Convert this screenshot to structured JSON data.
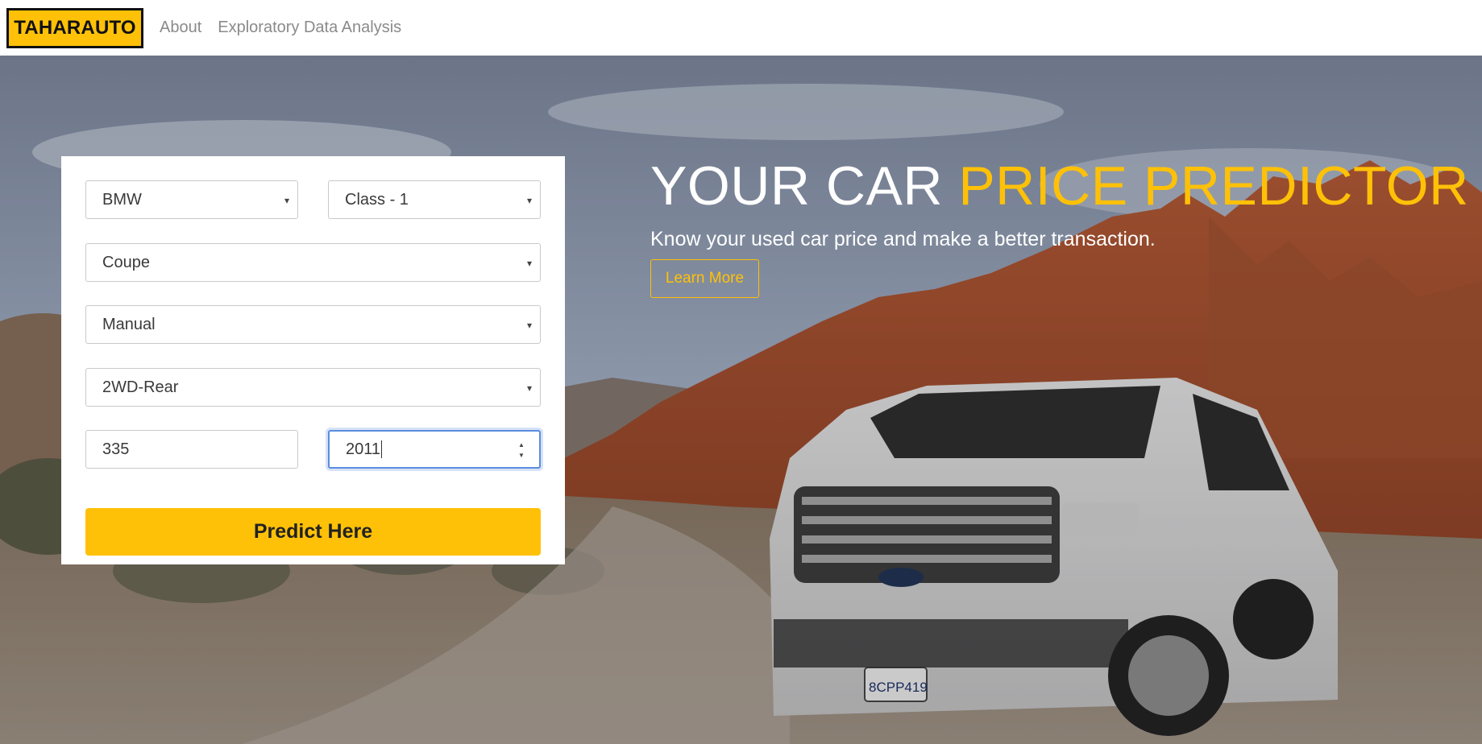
{
  "nav": {
    "brand": "TAHARAUTO",
    "links": [
      "About",
      "Exploratory Data Analysis"
    ]
  },
  "form": {
    "make": "BMW",
    "class": "Class - 1",
    "body": "Coupe",
    "transmission": "Manual",
    "drive": "2WD-Rear",
    "model": "335",
    "year": "2011",
    "submit_label": "Predict Here"
  },
  "hero": {
    "title_white": "YOUR CAR ",
    "title_accent": "PRICE PREDICTOR",
    "subtitle": "Know your used car price and make a better transaction.",
    "cta_label": "Learn More"
  },
  "colors": {
    "accent": "#ffc107",
    "brand_border": "#111111",
    "nav_text": "#8a8a8a"
  },
  "icons": {
    "select_caret": "▾",
    "spin_up": "▲",
    "spin_down": "▼"
  }
}
